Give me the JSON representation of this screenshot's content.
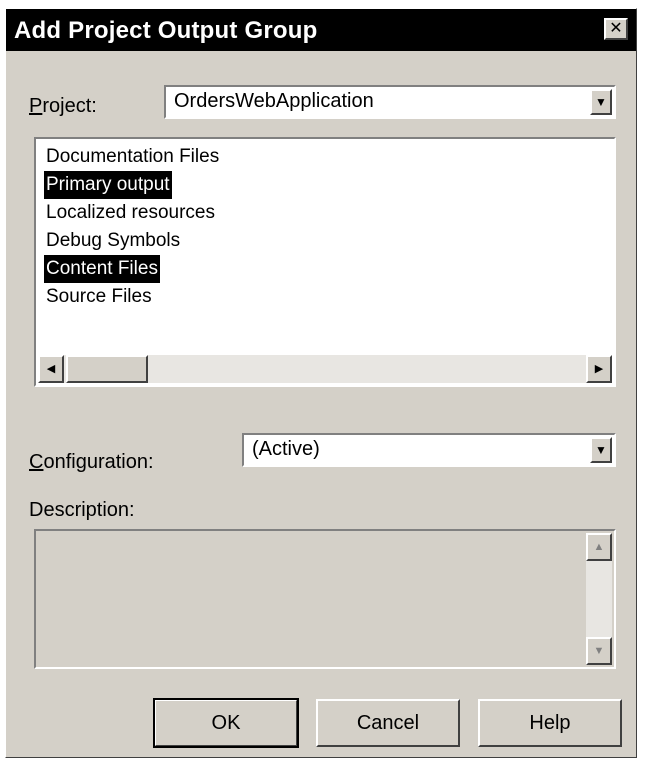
{
  "window": {
    "title": "Add Project Output Group",
    "close_glyph": "✕"
  },
  "project": {
    "label_mnemonic": "P",
    "label_rest": "roject:",
    "value": "OrdersWebApplication"
  },
  "output_list": {
    "items": [
      {
        "label": "Documentation Files",
        "selected": false
      },
      {
        "label": "Primary output",
        "selected": true
      },
      {
        "label": "Localized resources",
        "selected": false
      },
      {
        "label": "Debug Symbols",
        "selected": false
      },
      {
        "label": "Content Files",
        "selected": true
      },
      {
        "label": "Source Files",
        "selected": false
      }
    ]
  },
  "configuration": {
    "label_mnemonic": "C",
    "label_rest": "onfiguration:",
    "value": "(Active)"
  },
  "description": {
    "label": "Description:",
    "text": ""
  },
  "buttons": {
    "ok": "OK",
    "cancel": "Cancel",
    "help": "Help"
  },
  "icons": {
    "dropdown": "chevron-down-icon",
    "scroll_left": "arrow-left-icon",
    "scroll_right": "arrow-right-icon",
    "scroll_up": "arrow-up-icon",
    "scroll_down": "arrow-down-icon"
  }
}
